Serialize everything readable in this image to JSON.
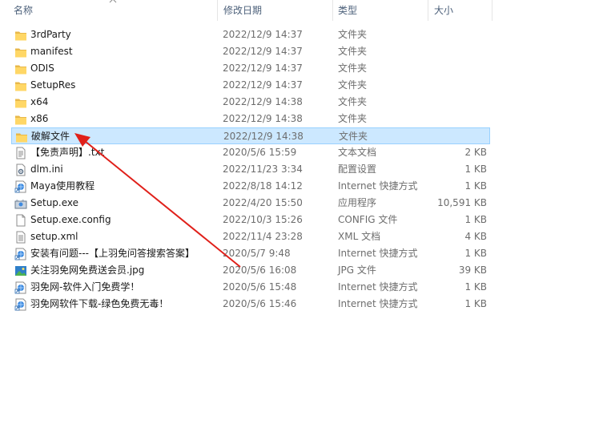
{
  "columns": {
    "name": "名称",
    "date": "修改日期",
    "type": "类型",
    "size": "大小"
  },
  "files": [
    {
      "name": "3rdParty",
      "date": "2022/12/9 14:37",
      "type": "文件夹",
      "size": "",
      "icon": "folder-icon"
    },
    {
      "name": "manifest",
      "date": "2022/12/9 14:37",
      "type": "文件夹",
      "size": "",
      "icon": "folder-icon"
    },
    {
      "name": "ODIS",
      "date": "2022/12/9 14:37",
      "type": "文件夹",
      "size": "",
      "icon": "folder-icon"
    },
    {
      "name": "SetupRes",
      "date": "2022/12/9 14:37",
      "type": "文件夹",
      "size": "",
      "icon": "folder-icon"
    },
    {
      "name": "x64",
      "date": "2022/12/9 14:38",
      "type": "文件夹",
      "size": "",
      "icon": "folder-icon"
    },
    {
      "name": "x86",
      "date": "2022/12/9 14:38",
      "type": "文件夹",
      "size": "",
      "icon": "folder-icon"
    },
    {
      "name": "破解文件",
      "date": "2022/12/9 14:38",
      "type": "文件夹",
      "size": "",
      "icon": "folder-icon",
      "selected": true
    },
    {
      "name": "【免责声明】.txt",
      "date": "2020/5/6 15:59",
      "type": "文本文档",
      "size": "2 KB",
      "icon": "text-file-icon"
    },
    {
      "name": "dlm.ini",
      "date": "2022/11/23 3:34",
      "type": "配置设置",
      "size": "1 KB",
      "icon": "settings-file-icon"
    },
    {
      "name": "Maya使用教程",
      "date": "2022/8/18 14:12",
      "type": "Internet 快捷方式",
      "size": "1 KB",
      "icon": "internet-shortcut-icon"
    },
    {
      "name": "Setup.exe",
      "date": "2022/4/20 15:50",
      "type": "应用程序",
      "size": "10,591 KB",
      "icon": "setup-app-icon"
    },
    {
      "name": "Setup.exe.config",
      "date": "2022/10/3 15:26",
      "type": "CONFIG 文件",
      "size": "1 KB",
      "icon": "blank-file-icon"
    },
    {
      "name": "setup.xml",
      "date": "2022/11/4 23:28",
      "type": "XML 文档",
      "size": "4 KB",
      "icon": "xml-file-icon"
    },
    {
      "name": "安装有问题---【上羽免问答搜索答案】",
      "date": "2020/5/7 9:48",
      "type": "Internet 快捷方式",
      "size": "1 KB",
      "icon": "internet-shortcut-icon"
    },
    {
      "name": "关注羽免网免费送会员.jpg",
      "date": "2020/5/6 16:08",
      "type": "JPG 文件",
      "size": "39 KB",
      "icon": "image-file-icon"
    },
    {
      "name": "羽免网-软件入门免费学！",
      "date": "2020/5/6 15:48",
      "type": "Internet 快捷方式",
      "size": "1 KB",
      "icon": "internet-shortcut-icon"
    },
    {
      "name": "羽免网软件下载-绿色免费无毒！",
      "date": "2020/5/6 15:46",
      "type": "Internet 快捷方式",
      "size": "1 KB",
      "icon": "internet-shortcut-icon"
    }
  ],
  "colors": {
    "selection_fill": "#cce8ff",
    "selection_border": "#99d1ff",
    "folder": "#ffd766",
    "annotation_arrow": "#e0201a"
  }
}
